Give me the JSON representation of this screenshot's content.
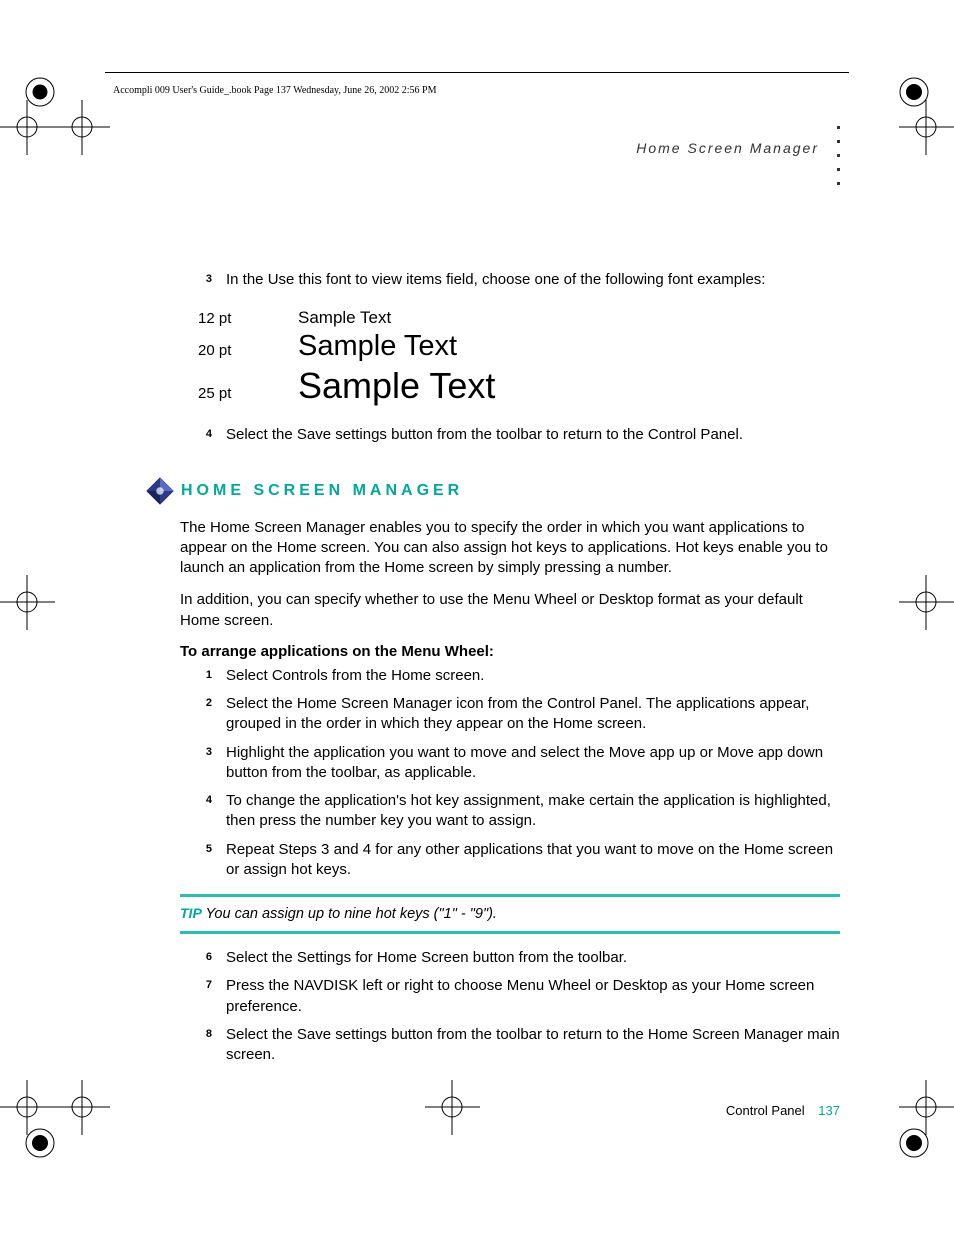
{
  "header_line": "Accompli 009 User's Guide_.book  Page 137  Wednesday, June 26, 2002  2:56 PM",
  "running_head": "Home Screen Manager",
  "top_steps": [
    {
      "n": "3",
      "t": "In the Use this font to view items field, choose one of the following font examples:"
    }
  ],
  "font_samples": [
    {
      "label": "12 pt",
      "text": "Sample Text",
      "cls": "sample-12"
    },
    {
      "label": "20 pt",
      "text": "Sample Text",
      "cls": "sample-20"
    },
    {
      "label": "25 pt",
      "text": "Sample Text",
      "cls": "sample-25"
    }
  ],
  "after_table_step": {
    "n": "4",
    "t": "Select the Save settings button from the toolbar to return to the Control Panel."
  },
  "section_heading": "HOME SCREEN MANAGER",
  "para1": "The Home Screen Manager enables you to specify the order in which you want applications to appear on the Home screen. You can also assign hot keys to applications. Hot keys enable you to launch an application from the Home screen by simply pressing a number.",
  "para2": "In addition, you can specify whether to use the Menu Wheel or Desktop format as your default Home screen.",
  "bold_intro": "To arrange applications on the Menu Wheel:",
  "steps_a": [
    {
      "n": "1",
      "t": "Select Controls from the Home screen."
    },
    {
      "n": "2",
      "t": "Select the Home Screen Manager icon from the Control Panel. The applications appear, grouped in the order in which they appear on the Home screen."
    },
    {
      "n": "3",
      "t": "Highlight the application you want to move and select the Move app up or Move app down button from the toolbar, as applicable."
    },
    {
      "n": "4",
      "t": "To change the application's hot key assignment, make certain the application is highlighted, then press the number key you want to assign."
    },
    {
      "n": "5",
      "t": "Repeat Steps 3 and 4 for any other applications that you want to move on the Home screen or assign hot keys."
    }
  ],
  "tip_label": "TIP",
  "tip_text": " You can assign up to nine hot keys (\"1\" - \"9\").",
  "steps_b": [
    {
      "n": "6",
      "t": "Select the Settings for Home Screen button from the toolbar."
    }
  ],
  "step7_prefix": "Press the N",
  "step7_sc": "AV",
  "step7_mid": "D",
  "step7_sc2": "ISK",
  "step7_suffix": " left or right to choose Menu Wheel or Desktop as your Home screen preference.",
  "steps_c": [
    {
      "n": "8",
      "t": "Select the Save settings button from the toolbar to return to the Home Screen Manager main screen."
    }
  ],
  "footer_label": "Control Panel",
  "footer_page": "137"
}
